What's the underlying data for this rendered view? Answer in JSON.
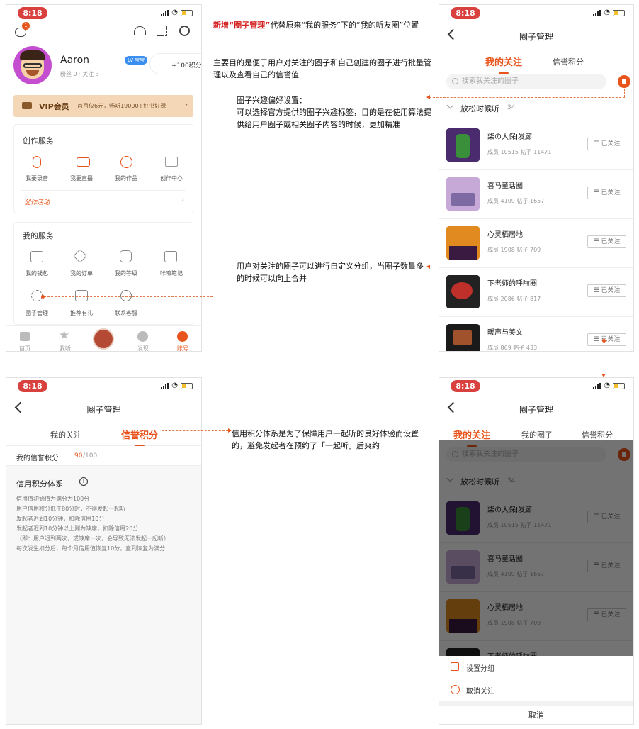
{
  "status": {
    "time": "8:18"
  },
  "profile": {
    "username": "Aaron",
    "badge": "LV 宝宝",
    "stats": "粉丝 0 · 关注 3",
    "points": "+100积分",
    "vip_label": "VIP会员",
    "vip_promo": "首月仅6元，畅听19000+好书好课",
    "chat_badge": "1"
  },
  "creation": {
    "title": "创作服务",
    "items": [
      "我要录音",
      "我要直播",
      "我的作品",
      "创作中心"
    ],
    "activity": "创作活动"
  },
  "services": {
    "title": "我的服务",
    "row1": [
      "我的钱包",
      "我的订单",
      "我的等级",
      "咔嚓笔记"
    ],
    "row2": [
      "圈子管理",
      "推荐有礼",
      "联系客服"
    ]
  },
  "tabbar": [
    "首页",
    "我听",
    "发现",
    "账号"
  ],
  "circle": {
    "nav_title": "圈子管理",
    "tab_following": "我的关注",
    "tab_my_circles": "我的圈子",
    "tab_credit": "信誉积分",
    "search_placeholder": "搜索我关注的圈子",
    "group_name": "放松时候听",
    "group_count": "34",
    "follow_label": "已关注",
    "items": [
      {
        "name": "柒の大保J发廊",
        "meta": "成员 10515  帖子 11471"
      },
      {
        "name": "喜马童话圈",
        "meta": "成员 4109  帖子 1657"
      },
      {
        "name": "心灵栖居地",
        "meta": "成员 1908  帖子 709"
      },
      {
        "name": "下老师的呼啦圈",
        "meta": "成员 2086  帖子 817"
      },
      {
        "name": "暖声与美文",
        "meta": "成员 869  帖子 433"
      }
    ]
  },
  "credit": {
    "my_score_label": "我的信誉积分",
    "score": "90",
    "score_total": "/100",
    "system_title": "信用积分体系",
    "rules": [
      "信用值初始值为满分为100分",
      "用户信用积分低于80分时，不得发起一起听",
      "发起者迟到10分钟，扣除信用10分",
      "发起者迟到10分钟以上则为缺席，扣除信用20分",
      "（即：用户迟到两次，或缺席一次，会导致无法发起一起听）",
      "每次发生扣分后，每个月信用值恢复10分，直到恢复为满分"
    ]
  },
  "sheet": {
    "set_group": "设置分组",
    "unfollow": "取消关注",
    "cancel": "取消"
  },
  "notes": {
    "n1_red": "新增“圈子管理”",
    "n1_rest": "代替原来“我的服务”下的“我的听友圈”位置",
    "n2": "主要目的是便于用户对关注的圈子和自己创建的圈子进行批量管理以及查看自己的信誉值",
    "n3_title": "圈子兴趣偏好设置：",
    "n3_body": "可以选择官方提供的圈子兴趣标签，目的是在使用算法提供给用户圈子或相关圈子内容的时候，更加精准",
    "n4": "用户对关注的圈子可以进行自定义分组，当圈子数量多的时候可以向上合并",
    "n5": "信用积分体系是为了保障用户一起听的良好体验而设置的，避免发起者在预约了「一起听」后爽约"
  }
}
